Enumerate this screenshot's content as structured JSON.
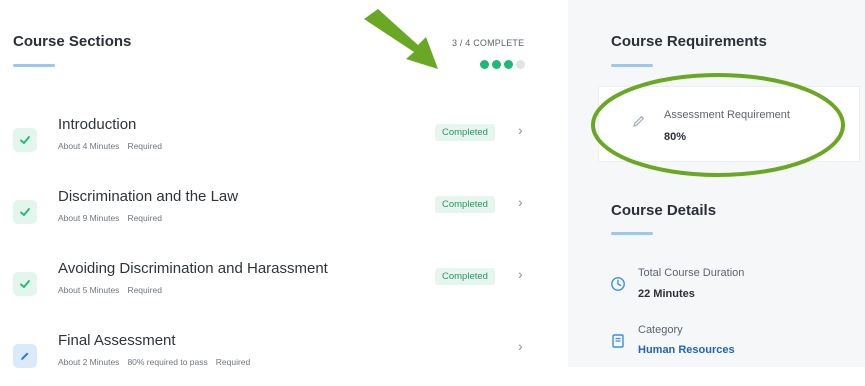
{
  "course_sections": {
    "title": "Course Sections",
    "progress_label": "3 / 4 COMPLETE",
    "progress": {
      "completed": 3,
      "total": 4
    },
    "items": [
      {
        "title": "Introduction",
        "meta": [
          "About 4 Minutes",
          "Required"
        ],
        "status": "Completed",
        "icon": "check-icon"
      },
      {
        "title": "Discrimination and the Law",
        "meta": [
          "About 9 Minutes",
          "Required"
        ],
        "status": "Completed",
        "icon": "check-icon"
      },
      {
        "title": "Avoiding Discrimination and Harassment",
        "meta": [
          "About 5 Minutes",
          "Required"
        ],
        "status": "Completed",
        "icon": "check-icon"
      },
      {
        "title": "Final Assessment",
        "meta": [
          "About 2 Minutes",
          "80% required to pass",
          "Required"
        ],
        "status": "",
        "icon": "pencil-icon"
      }
    ]
  },
  "course_requirements": {
    "title": "Course Requirements",
    "assessment_label": "Assessment Requirement",
    "assessment_value": "80%"
  },
  "course_details": {
    "title": "Course Details",
    "duration_label": "Total Course Duration",
    "duration_value": "22 Minutes",
    "category_label": "Category",
    "category_value": "Human Resources"
  },
  "colors": {
    "accent_green": "#1fb875",
    "annotation_green": "#6aa823",
    "link_blue": "#1a64c4",
    "underline_blue": "#9bc8ef"
  }
}
